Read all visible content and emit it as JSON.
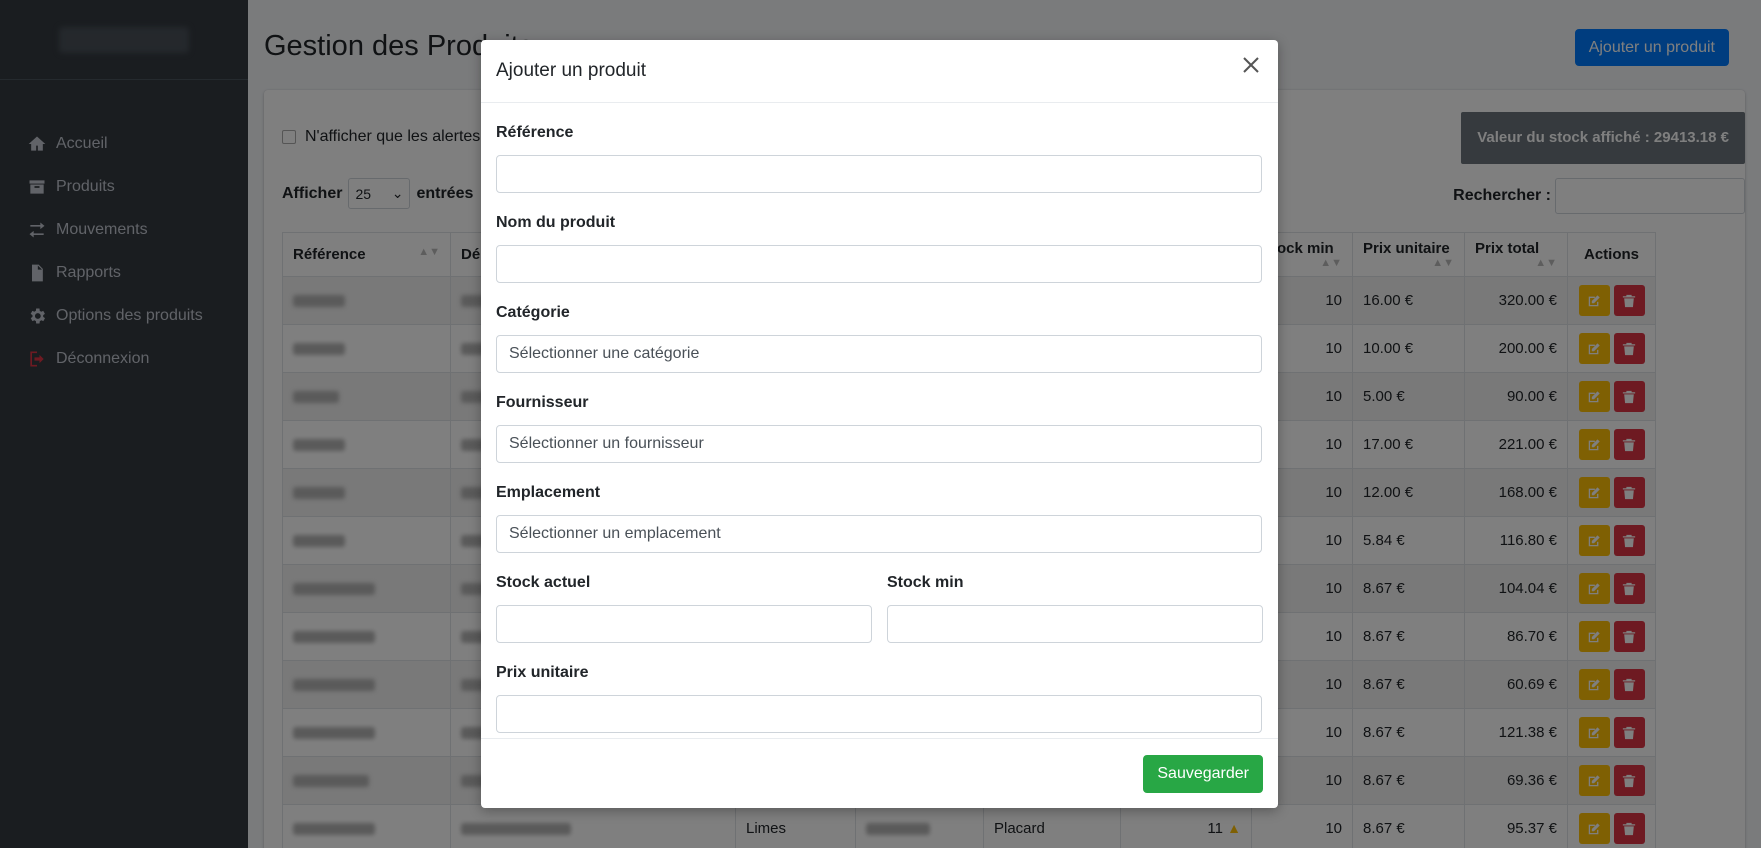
{
  "sidebar": {
    "items": [
      {
        "label": "Accueil",
        "icon": "home-icon"
      },
      {
        "label": "Produits",
        "icon": "box-icon"
      },
      {
        "label": "Mouvements",
        "icon": "exchange-icon"
      },
      {
        "label": "Rapports",
        "icon": "file-icon"
      },
      {
        "label": "Options des produits",
        "icon": "gear-icon"
      },
      {
        "label": "Déconnexion",
        "icon": "logout-icon"
      }
    ]
  },
  "page": {
    "title": "Gestion des Produits",
    "add_button": "Ajouter un produit",
    "alerts_only_label": "N'afficher que les alertes",
    "stock_value": "Valeur du stock affiché : 29413.18 €",
    "show_label": "Afficher",
    "show_value": "25",
    "entries_label": "entrées",
    "search_label": "Rechercher :"
  },
  "table": {
    "headers": [
      "Référence",
      "Dé",
      "",
      "",
      "",
      "",
      "Stock min",
      "Prix unitaire",
      "Prix total",
      "Actions"
    ],
    "rows": [
      {
        "stock_min": "10",
        "unit": "16.00 €",
        "total": "320.00 €"
      },
      {
        "stock_min": "10",
        "unit": "10.00 €",
        "total": "200.00 €"
      },
      {
        "stock_min": "10",
        "unit": "5.00 €",
        "total": "90.00 €"
      },
      {
        "stock_min": "10",
        "unit": "17.00 €",
        "total": "221.00 €"
      },
      {
        "stock_min": "10",
        "unit": "12.00 €",
        "total": "168.00 €"
      },
      {
        "stock_min": "10",
        "unit": "5.84 €",
        "total": "116.80 €"
      },
      {
        "stock_min": "10",
        "unit": "8.67 €",
        "total": "104.04 €"
      },
      {
        "stock_min": "10",
        "unit": "8.67 €",
        "total": "86.70 €"
      },
      {
        "stock_min": "10",
        "unit": "8.67 €",
        "total": "60.69 €"
      },
      {
        "stock_min": "10",
        "unit": "8.67 €",
        "total": "121.38 €"
      },
      {
        "stock_min": "10",
        "unit": "8.67 €",
        "total": "69.36 €"
      },
      {
        "category": "Limes",
        "location": "Placard",
        "stock": "11",
        "stock_min": "10",
        "unit": "8.67 €",
        "total": "95.37 €"
      }
    ]
  },
  "modal": {
    "title": "Ajouter un produit",
    "fields": {
      "reference": {
        "label": "Référence",
        "value": ""
      },
      "name": {
        "label": "Nom du produit",
        "value": ""
      },
      "category": {
        "label": "Catégorie",
        "value": "Sélectionner une catégorie"
      },
      "supplier": {
        "label": "Fournisseur",
        "value": "Sélectionner un fournisseur"
      },
      "location": {
        "label": "Emplacement",
        "value": "Sélectionner un emplacement"
      },
      "stock": {
        "label": "Stock actuel",
        "value": ""
      },
      "stock_min": {
        "label": "Stock min",
        "value": ""
      },
      "unit_price": {
        "label": "Prix unitaire",
        "value": ""
      }
    },
    "save_button": "Sauvegarder"
  },
  "colors": {
    "sidebar": "#343a40",
    "primary": "#007bff",
    "success": "#28a745",
    "warning": "#ffc107",
    "danger": "#dc3545",
    "secondary": "#6c757d"
  }
}
